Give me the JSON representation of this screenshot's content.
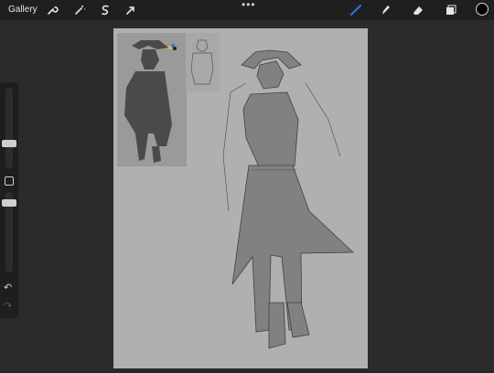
{
  "topbar": {
    "gallery_label": "Gallery",
    "left_tools": [
      {
        "name": "wrench-icon"
      },
      {
        "name": "magic-wand-icon"
      },
      {
        "name": "selection-icon"
      },
      {
        "name": "transform-arrow-icon"
      }
    ],
    "more_menu": "•••",
    "right_tools": [
      {
        "name": "brush-icon",
        "active": true
      },
      {
        "name": "smudge-icon",
        "active": false
      },
      {
        "name": "eraser-icon",
        "active": false
      },
      {
        "name": "layers-icon",
        "active": false
      }
    ],
    "active_color": "#000000"
  },
  "sidebar": {
    "undo": "↶",
    "redo": "↷"
  },
  "colors": {
    "brush_accent": "#2f6fe0",
    "topbar_bg": "#1f1f1f",
    "canvas_bg": "#2b2b2b",
    "paper_bg": "#b0b0b0"
  }
}
